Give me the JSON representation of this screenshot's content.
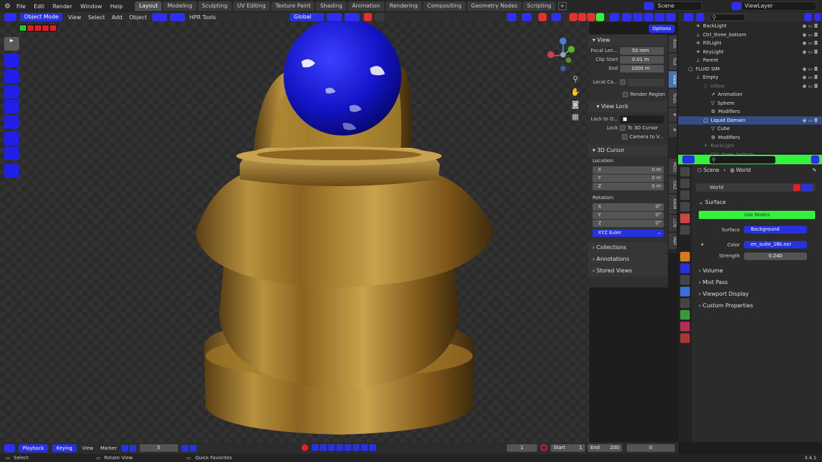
{
  "menu": [
    "File",
    "Edit",
    "Render",
    "Window",
    "Help"
  ],
  "workspaces": [
    "Layout",
    "Modeling",
    "Sculpting",
    "UV Editing",
    "Texture Paint",
    "Shading",
    "Animation",
    "Rendering",
    "Compositing",
    "Geometry Nodes",
    "Scripting"
  ],
  "active_workspace": "Layout",
  "scene_name": "Scene",
  "view_layer": "ViewLayer",
  "header": {
    "mode": "Object Mode",
    "menus": [
      "View",
      "Select",
      "Add",
      "Object"
    ],
    "addon": "HPR Tools",
    "orientation": "Global",
    "options": "Options"
  },
  "npanel": {
    "view_title": "View",
    "focal_label": "Focal Len...",
    "focal_value": "50 mm",
    "clip_start_label": "Clip Start",
    "clip_start_value": "0.01 m",
    "end_label": "End",
    "end_value": "1000 m",
    "local_camera_label": "Local Ca...",
    "render_region": "Render Region",
    "view_lock_title": "View Lock",
    "lock_to_label": "Lock to O...",
    "lock_label": "Lock",
    "to_3d_cursor": "To 3D Cursor",
    "camera_to_view": "Camera to V...",
    "cursor_title": "3D Cursor",
    "location_label": "Location:",
    "loc_x": "0 m",
    "loc_y": "0 m",
    "loc_z": "0 m",
    "rotation_label": "Rotation:",
    "rot_x": "0°",
    "rot_y": "0°",
    "rot_z": "0°",
    "axis_x": "X",
    "axis_y": "Y",
    "axis_z": "Z",
    "rotation_mode": "XYZ Euler",
    "collections": "Collections",
    "annotations": "Annotations",
    "stored_views": "Stored Views"
  },
  "vtabs": [
    "Item",
    "Tool",
    "View",
    "Tools",
    "#",
    "#",
    "MOD",
    "DAZ",
    "ANIM",
    "LCN",
    "MAT"
  ],
  "outliner": [
    {
      "name": "BackLight",
      "indent": 2
    },
    {
      "name": "Ctrl_three_bottom",
      "indent": 2
    },
    {
      "name": "FillLight",
      "indent": 2
    },
    {
      "name": "KeyLight",
      "indent": 2
    },
    {
      "name": "Parent",
      "indent": 2
    },
    {
      "name": "FLUID SIM",
      "indent": 1
    },
    {
      "name": "Empty",
      "indent": 2
    },
    {
      "name": "Inflow",
      "indent": 3
    },
    {
      "name": "Animation",
      "indent": 4
    },
    {
      "name": "Sphere",
      "indent": 4
    },
    {
      "name": "Modifiers",
      "indent": 4
    },
    {
      "name": "Liquid Domain",
      "indent": 3
    },
    {
      "name": "Cube",
      "indent": 4
    },
    {
      "name": "Modifiers",
      "indent": 4
    },
    {
      "name": "BackLight",
      "indent": 3
    },
    {
      "name": "Ctrl_three_bottom",
      "indent": 3
    }
  ],
  "properties": {
    "breadcrumb_scene": "Scene",
    "breadcrumb_world": "World",
    "world_name": "World",
    "surface_title": "Surface",
    "use_nodes": "Use Nodes",
    "surface_label": "Surface",
    "surface_value": "Background",
    "color_label": "Color",
    "color_value": "en_suite_16k.exr",
    "strength_label": "Strength",
    "strength_value": "0.240",
    "volume": "Volume",
    "mist_pass": "Mist Pass",
    "viewport_display": "Viewport Display",
    "custom_properties": "Custom Properties"
  },
  "timeline": {
    "playback": "Playback",
    "keying": "Keying",
    "view": "View",
    "marker": "Marker",
    "left_frame": "5",
    "current_frame": "1",
    "start_label": "Start",
    "start_value": "1",
    "end_label": "End",
    "end_value": "200",
    "frame_field": "0"
  },
  "status": {
    "select": "Select",
    "rotate": "Rotate View",
    "quick_fav": "Quick Favorites",
    "version": "3.4.1"
  },
  "colors": {
    "accent_blue": "#2632e2",
    "green_header": "#36f040",
    "gold": "#a37a2b",
    "sphere_blue": "#1c1fdc"
  }
}
